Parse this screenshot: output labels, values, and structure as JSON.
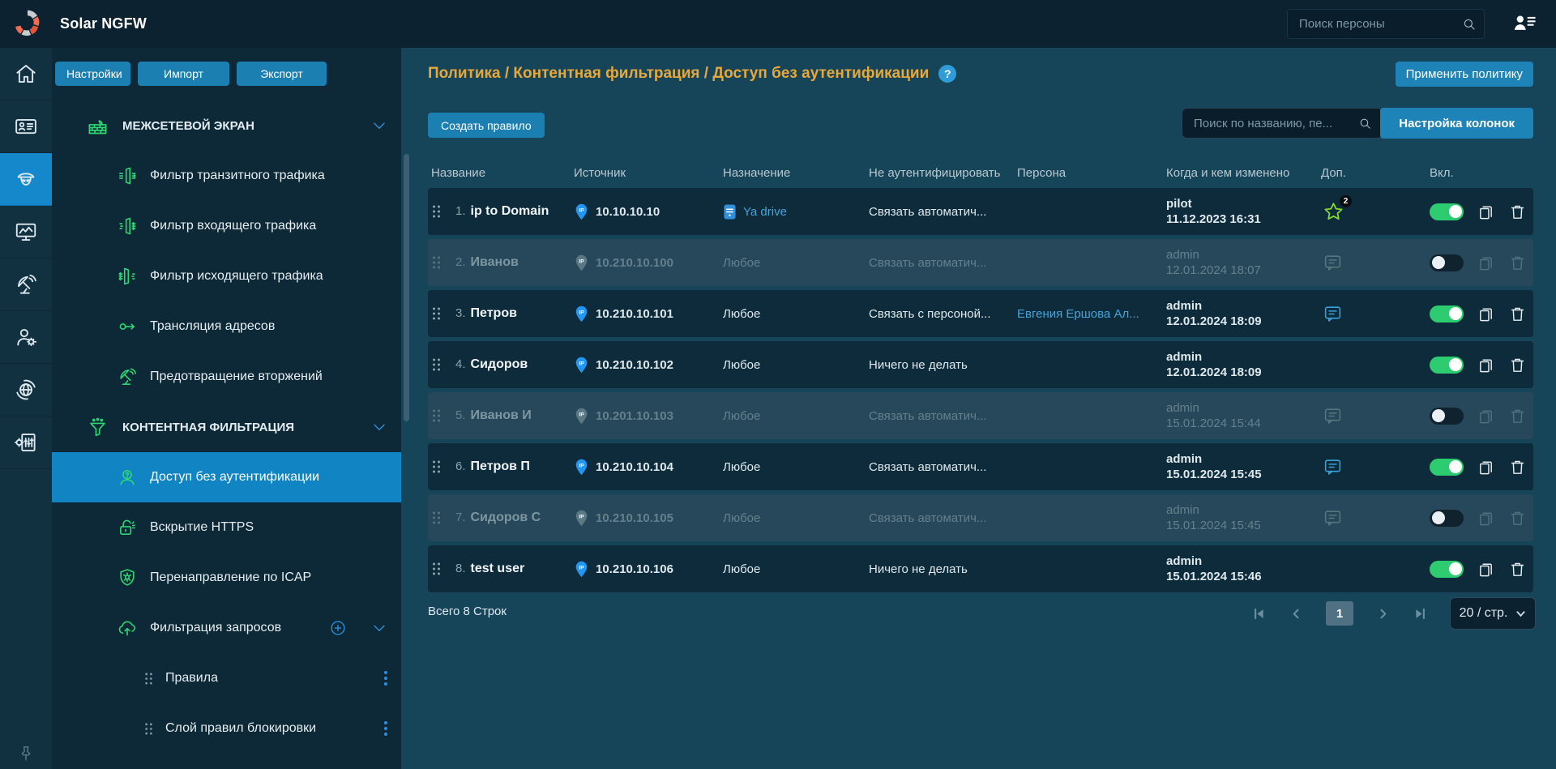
{
  "topbar": {
    "app_title": "Solar NGFW",
    "search_placeholder": "Поиск персоны"
  },
  "sidebar": {
    "items": [
      {
        "name": "home",
        "icon": "home",
        "selected": false
      },
      {
        "name": "persons",
        "icon": "id-card",
        "selected": false
      },
      {
        "name": "policy",
        "icon": "police",
        "selected": true
      },
      {
        "name": "dashboard",
        "icon": "dashboard",
        "selected": false
      },
      {
        "name": "monitoring",
        "icon": "satellite",
        "selected": false
      },
      {
        "name": "user-administration",
        "icon": "user-gear",
        "selected": false
      },
      {
        "name": "network",
        "icon": "globe",
        "selected": false
      },
      {
        "name": "system-settings",
        "icon": "doc-settings",
        "selected": false
      }
    ],
    "pin_icon": "pin"
  },
  "menu": {
    "action_buttons": [
      {
        "label": "Настройки"
      },
      {
        "label": "Импорт"
      },
      {
        "label": "Экспорт"
      }
    ],
    "groups": [
      {
        "label": "МЕЖСЕТЕВОЙ ЭКРАН",
        "icon": "firewall",
        "items": [
          {
            "label": "Фильтр транзитного трафика",
            "icon": "filter-transit"
          },
          {
            "label": "Фильтр входящего трафика",
            "icon": "filter-in"
          },
          {
            "label": "Фильтр исходящего трафика",
            "icon": "filter-out"
          },
          {
            "label": "Трансляция адресов",
            "icon": "nat"
          },
          {
            "label": "Предотвращение вторжений",
            "icon": "ips"
          }
        ]
      },
      {
        "label": "КОНТЕНТНАЯ ФИЛЬТРАЦИЯ",
        "icon": "funnel",
        "items": [
          {
            "label": "Доступ без аутентификации",
            "icon": "person-question",
            "selected": true
          },
          {
            "label": "Вскрытие HTTPS",
            "icon": "lock-open"
          },
          {
            "label": "Перенаправление по ICAP",
            "icon": "shield-virus"
          },
          {
            "label": "Фильтрация запросов",
            "icon": "cloud-up",
            "plus": true,
            "children": [
              {
                "label": "Правила"
              },
              {
                "label": "Слой правил блокировки"
              }
            ]
          }
        ]
      }
    ]
  },
  "header": {
    "breadcrumb": "Политика / Контентная фильтрация / Доступ без аутентификации",
    "help": "?",
    "apply_button": "Применить политику"
  },
  "toolbar": {
    "create_button": "Создать правило",
    "search_placeholder": "Поиск по названию, пе...",
    "columns_button": "Настройка колонок"
  },
  "table": {
    "columns": [
      "Название",
      "Источник",
      "Назначение",
      "Не аутентифицировать",
      "Персона",
      "Когда и кем изменено",
      "Доп.",
      "Вкл."
    ],
    "rows": [
      {
        "num": "1.",
        "name": "ip to Domain",
        "source": "10.10.10.10",
        "dest": "Ya drive",
        "dest_type": "yadrive",
        "action": "Связать автоматич...",
        "persona": "",
        "changed_by": "pilot",
        "changed_at": "11.12.2023 16:31",
        "extra": "favorite",
        "extra_badge": "2",
        "enabled": true,
        "dimmed": false
      },
      {
        "num": "2.",
        "name": "Иванов",
        "source": "10.210.10.100",
        "dest": "Любое",
        "dest_type": "any",
        "action": "Связать автоматич...",
        "persona": "",
        "changed_by": "admin",
        "changed_at": "12.01.2024 18:07",
        "extra": "comment",
        "enabled": false,
        "dimmed": true
      },
      {
        "num": "3.",
        "name": "Петров",
        "source": "10.210.10.101",
        "dest": "Любое",
        "dest_type": "any",
        "action": "Связать с персоной...",
        "persona": "Евгения Ершова Ал...",
        "changed_by": "admin",
        "changed_at": "12.01.2024 18:09",
        "extra": "comment",
        "enabled": true,
        "dimmed": false
      },
      {
        "num": "4.",
        "name": "Сидоров",
        "source": "10.210.10.102",
        "dest": "Любое",
        "dest_type": "any",
        "action": "Ничего не делать",
        "persona": "",
        "changed_by": "admin",
        "changed_at": "12.01.2024 18:09",
        "extra": "none",
        "enabled": true,
        "dimmed": false
      },
      {
        "num": "5.",
        "name": "Иванов И",
        "source": "10.201.10.103",
        "dest": "Любое",
        "dest_type": "any",
        "action": "Связать автоматич...",
        "persona": "",
        "changed_by": "admin",
        "changed_at": "15.01.2024 15:44",
        "extra": "comment",
        "enabled": false,
        "dimmed": true
      },
      {
        "num": "6.",
        "name": "Петров П",
        "source": "10.210.10.104",
        "dest": "Любое",
        "dest_type": "any",
        "action": "Связать автоматич...",
        "persona": "",
        "changed_by": "admin",
        "changed_at": "15.01.2024 15:45",
        "extra": "comment",
        "enabled": true,
        "dimmed": false
      },
      {
        "num": "7.",
        "name": "Сидоров С",
        "source": "10.210.10.105",
        "dest": "Любое",
        "dest_type": "any",
        "action": "Связать автоматич...",
        "persona": "",
        "changed_by": "admin",
        "changed_at": "15.01.2024 15:45",
        "extra": "comment",
        "enabled": false,
        "dimmed": true
      },
      {
        "num": "8.",
        "name": "test user",
        "source": "10.210.10.106",
        "dest": "Любое",
        "dest_type": "any",
        "action": "Ничего не делать",
        "persona": "",
        "changed_by": "admin",
        "changed_at": "15.01.2024 15:46",
        "extra": "none",
        "enabled": true,
        "dimmed": false
      }
    ]
  },
  "footer": {
    "total": "Всего 8 Строк",
    "current_page": "1",
    "page_size": "20 / стр."
  },
  "colors": {
    "accent_button": "#1b7fb2",
    "selected_item": "#1184c4",
    "toggle_on": "#2ecc71",
    "link": "#44a4da",
    "breadcrumb": "#e7a83b",
    "menu_icon_green": "#2ed573",
    "row_bg": "#0d2b3a",
    "row_dimmed_bg": "#26485a"
  }
}
